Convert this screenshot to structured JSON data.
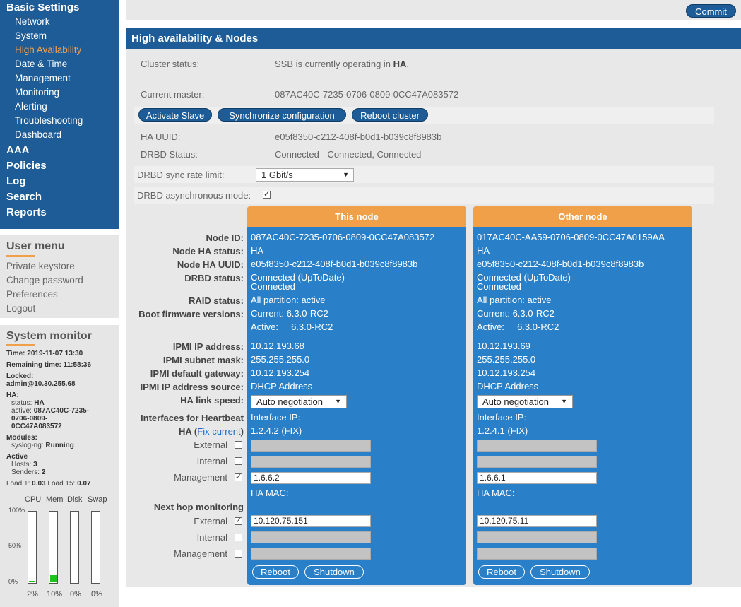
{
  "nav": {
    "basic_settings": "Basic Settings",
    "sub_items": [
      "Network",
      "System",
      "High Availability",
      "Date & Time",
      "Management",
      "Monitoring",
      "Alerting",
      "Troubleshooting",
      "Dashboard"
    ],
    "active_item": "High Availability",
    "top_items": [
      "AAA",
      "Policies",
      "Log",
      "Search",
      "Reports"
    ]
  },
  "user_menu": {
    "title": "User menu",
    "items": [
      "Private keystore",
      "Change password",
      "Preferences",
      "Logout"
    ]
  },
  "system_monitor": {
    "title": "System monitor",
    "time_label": "Time:",
    "time": "2019-11-07 13:30",
    "remaining_label": "Remaining time:",
    "remaining": "11:58:36",
    "locked_label": "Locked:",
    "locked": "admin@10.30.255.68",
    "ha_label": "HA:",
    "status_label": "status:",
    "status": "HA",
    "active_label": "active:",
    "active_line1": "087AC40C-7235-",
    "active_line2": "0706-0809-",
    "active_line3": "0CC47A083572",
    "modules_label": "Modules:",
    "module_name": "syslog-ng:",
    "module_status": "Running",
    "active_section": "Active",
    "hosts_label": "Hosts:",
    "hosts": "3",
    "senders_label": "Senders:",
    "senders": "2",
    "load1_label": "Load 1:",
    "load1": "0.03",
    "load15_label": "Load 15:",
    "load15": "0.07",
    "bar_headers": [
      "CPU",
      "Mem",
      "Disk",
      "Swap"
    ],
    "y_ticks": [
      "100%",
      "50%",
      "0%"
    ],
    "bars": [
      {
        "name": "CPU",
        "percent": "2%",
        "fraction": 0.02
      },
      {
        "name": "Mem",
        "percent": "10%",
        "fraction": 0.1
      },
      {
        "name": "Disk",
        "percent": "0%",
        "fraction": 0.0
      },
      {
        "name": "Swap",
        "percent": "0%",
        "fraction": 0.0
      }
    ],
    "bar_color": "#1ec21e"
  },
  "toolbar": {
    "commit_label": "Commit"
  },
  "section": {
    "title": "High availability & Nodes",
    "cluster_status_label": "Cluster status:",
    "cluster_status_prefix": "SSB is currently operating in ",
    "cluster_status_mode": "HA",
    "cluster_status_suffix": ".",
    "current_master_label": "Current master:",
    "current_master": "087AC40C-7235-0706-0809-0CC47A083572",
    "buttons": {
      "activate_slave": "Activate Slave",
      "sync_config": "Synchronize configuration",
      "reboot_cluster": "Reboot cluster"
    },
    "ha_uuid_label": "HA UUID:",
    "ha_uuid": "e05f8350-c212-408f-b0d1-b039c8f8983b",
    "drbd_status_label": "DRBD Status:",
    "drbd_status": "Connected - Connected, Connected",
    "drbd_sync_label": "DRBD sync rate limit:",
    "drbd_sync_value": "1 Gbit/s",
    "drbd_async_label": "DRBD asynchronous mode:"
  },
  "row_labels": {
    "node_id": "Node ID:",
    "node_ha_status": "Node HA status:",
    "node_ha_uuid": "Node HA UUID:",
    "drbd_status": "DRBD status:",
    "raid_status": "RAID status:",
    "boot_fw": "Boot firmware versions:",
    "ipmi_ip": "IPMI IP address:",
    "ipmi_mask": "IPMI subnet mask:",
    "ipmi_gw": "IPMI default gateway:",
    "ipmi_src": "IPMI IP address source:",
    "ha_link_speed": "HA link speed:",
    "interfaces_hb": "Interfaces for Heartbeat",
    "ha_prefix": "HA (",
    "fix_current": "Fix current",
    "ha_suffix": ")",
    "external": "External",
    "internal": "Internal",
    "management": "Management",
    "next_hop": "Next hop monitoring",
    "external2": "External",
    "internal2": "Internal",
    "management2": "Management"
  },
  "nodes": [
    {
      "header": "This node",
      "node_id": "087AC40C-7235-0706-0809-0CC47A083572",
      "ha_status": "HA",
      "ha_uuid": "e05f8350-c212-408f-b0d1-b039c8f8983b",
      "drbd_line1": "Connected (UpToDate)",
      "drbd_line2": "Connected",
      "raid": "All partition: active",
      "fw_current": "Current:  6.3.0-RC2",
      "fw_active": "Active:     6.3.0-RC2",
      "ipmi_ip": "10.12.193.68",
      "ipmi_mask": "255.255.255.0",
      "ipmi_gw": "10.12.193.254",
      "ipmi_src": "DHCP Address",
      "link_speed": "Auto negotiation",
      "interface_ip_label": "Interface IP:",
      "ha_ip": "1.2.4.2 (FIX)",
      "mgmt_ip": "1.6.6.2",
      "ha_mac_label": "HA MAC:",
      "next_hop_external": "10.120.75.151",
      "reboot": "Reboot",
      "shutdown": "Shutdown"
    },
    {
      "header": "Other node",
      "node_id": "017AC40C-AA59-0706-0809-0CC47A0159AA",
      "ha_status": "HA",
      "ha_uuid": "e05f8350-c212-408f-b0d1-b039c8f8983b",
      "drbd_line1": "Connected (UpToDate)",
      "drbd_line2": "Connected",
      "raid": "All partition: active",
      "fw_current": "Current:  6.3.0-RC2",
      "fw_active": "Active:     6.3.0-RC2",
      "ipmi_ip": "10.12.193.69",
      "ipmi_mask": "255.255.255.0",
      "ipmi_gw": "10.12.193.254",
      "ipmi_src": "DHCP Address",
      "link_speed": "Auto negotiation",
      "interface_ip_label": "Interface IP:",
      "ha_ip": "1.2.4.1 (FIX)",
      "mgmt_ip": "1.6.6.1",
      "ha_mac_label": "HA MAC:",
      "next_hop_external": "10.120.75.11",
      "reboot": "Reboot",
      "shutdown": "Shutdown"
    }
  ],
  "colors": {
    "primary": "#1d5c96",
    "accent": "#f1a04a",
    "card": "#2a80c8"
  }
}
